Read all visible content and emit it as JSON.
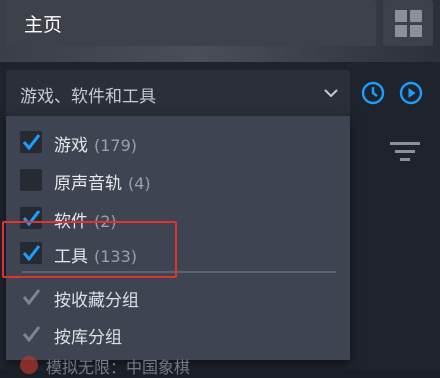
{
  "header": {
    "title": "主页"
  },
  "filter": {
    "selected": "游戏、软件和工具"
  },
  "dropdown": {
    "options": [
      {
        "label": "游戏",
        "count": "(179)",
        "checked": true
      },
      {
        "label": "原声音轨",
        "count": "(4)",
        "checked": false
      },
      {
        "label": "软件",
        "count": "(2)",
        "checked": true
      },
      {
        "label": "工具",
        "count": "(133)",
        "checked": true
      }
    ],
    "group_options": [
      {
        "label": "按收藏分组",
        "checked": true,
        "disabled": true
      },
      {
        "label": "按库分组",
        "checked": true,
        "disabled": true
      }
    ]
  },
  "partial_item": {
    "label": "模拟无限：中国象棋"
  },
  "colors": {
    "accent": "#1a9fff",
    "highlight_border": "#e0322f"
  }
}
